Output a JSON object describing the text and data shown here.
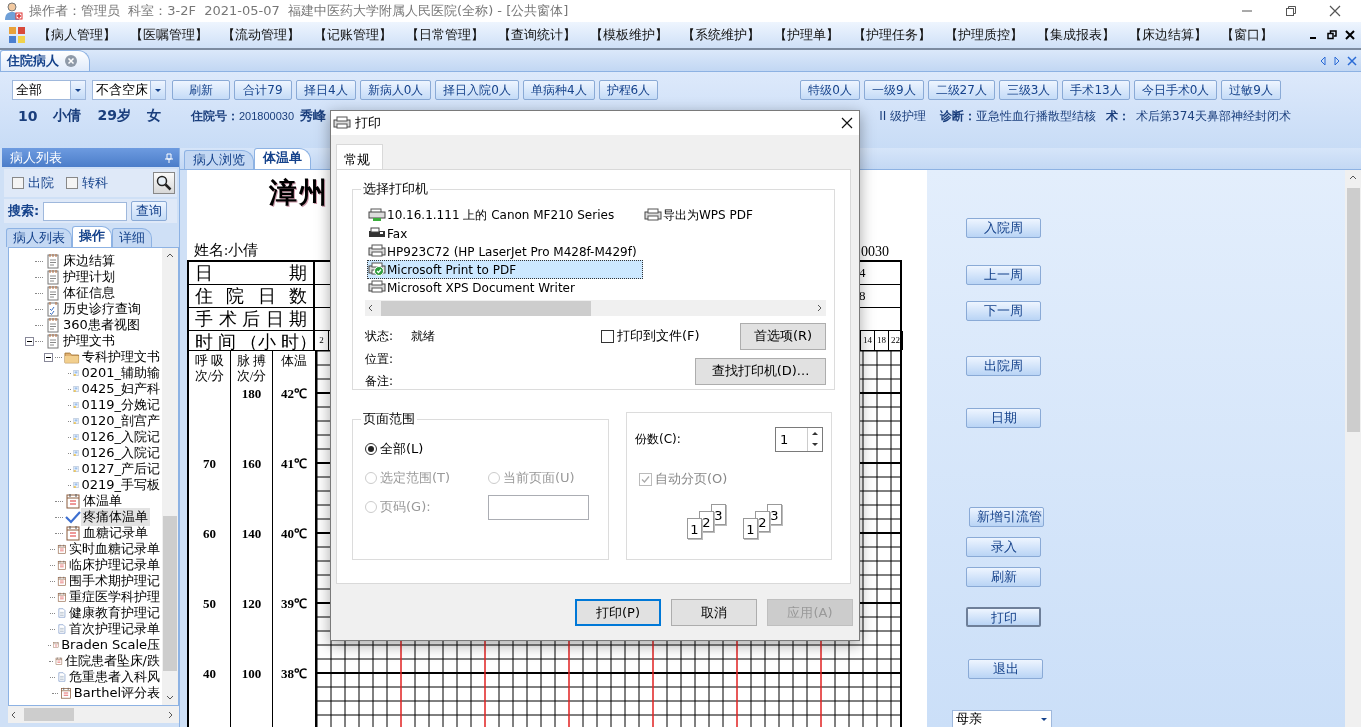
{
  "window": {
    "title": "操作者：管理员  科室：3-2F  2021-05-07  福建中医药大学附属人民医院(全称) - [公共窗体]"
  },
  "menu": [
    "【病人管理】",
    "【医嘱管理】",
    "【流动管理】",
    "【记账管理】",
    "【日常管理】",
    "【查询统计】",
    "【模板维护】",
    "【系统维护】",
    "【护理单】",
    "【护理任务】",
    "【护理质控】",
    "【集成报表】",
    "【床边结算】",
    "【窗口】"
  ],
  "document_tabs": [
    {
      "label": "住院病人",
      "selected": true
    }
  ],
  "toolbar": {
    "filters": [
      "全部",
      "不含空床"
    ],
    "buttons_left": [
      "刷新",
      "合计79",
      "择日4人",
      "新病人0人",
      "择日入院0人",
      "单病种4人",
      "护程6人"
    ],
    "buttons_right": [
      "特级0人",
      "一级9人",
      "二级27人",
      "三级3人",
      "手术13人",
      "今日手术0人",
      "过敏9人"
    ]
  },
  "patient": {
    "bed": "10",
    "name": "小倩",
    "age": "29岁",
    "sex": "女",
    "admission_label": "住院号：",
    "admission_no": "201800030",
    "address": "秀峰",
    "nursing_level": "II 级护理",
    "diagnosis_label": "诊断：",
    "diagnosis": "亚急性血行播散型结核",
    "surgery_label": "术：",
    "surgery": "术后第374天鼻部神经封闭术"
  },
  "patient_panel": {
    "title": "病人列表",
    "filters": [
      {
        "label": "出院",
        "checked": false
      },
      {
        "label": "转科",
        "checked": false
      }
    ],
    "search_label": "搜索:",
    "search_button": "查询",
    "tabs": [
      {
        "label": "病人列表",
        "selected": false
      },
      {
        "label": "操作",
        "selected": true
      },
      {
        "label": "详细",
        "selected": false
      }
    ],
    "tree": [
      {
        "label": "床边结算",
        "kind": "note",
        "selected": false
      },
      {
        "label": "护理计划",
        "kind": "note",
        "selected": false
      },
      {
        "label": "体征信息",
        "kind": "note",
        "selected": false
      },
      {
        "label": "历史诊疗查询",
        "kind": "checklist",
        "selected": false
      },
      {
        "label": "360患者视图",
        "kind": "note",
        "selected": false
      },
      {
        "label": "护理文书",
        "kind": "note",
        "selected": false,
        "expanded": true,
        "children": [
          {
            "label": "专科护理文书",
            "kind": "folder",
            "selected": false,
            "expanded": true,
            "children": [
              {
                "label": "0201_辅助输",
                "kind": "template",
                "selected": false
              },
              {
                "label": "0425_妇产科",
                "kind": "template",
                "selected": false
              },
              {
                "label": "0119_分娩记",
                "kind": "template",
                "selected": false
              },
              {
                "label": "0120_剖宫产",
                "kind": "template",
                "selected": false
              },
              {
                "label": "0126_入院记",
                "kind": "template",
                "selected": false
              },
              {
                "label": "0126_入院记",
                "kind": "template",
                "selected": false
              },
              {
                "label": "0127_产后记",
                "kind": "template",
                "selected": false
              },
              {
                "label": "0219_手写板",
                "kind": "template",
                "selected": false
              }
            ]
          },
          {
            "label": "体温单",
            "kind": "form",
            "selected": false
          },
          {
            "label": "疼痛体温单",
            "kind": "check",
            "selected": true
          },
          {
            "label": "血糖记录单",
            "kind": "form",
            "selected": false
          },
          {
            "label": "实时血糖记录单",
            "kind": "form",
            "selected": false
          },
          {
            "label": "临床护理记录单",
            "kind": "form",
            "selected": false
          },
          {
            "label": "围手术期护理记",
            "kind": "form",
            "selected": false
          },
          {
            "label": "重症医学科护理",
            "kind": "form",
            "selected": false
          },
          {
            "label": "健康教育护理记",
            "kind": "page",
            "selected": false
          },
          {
            "label": "首次护理记录单",
            "kind": "page",
            "selected": false
          },
          {
            "label": "Braden Scale压",
            "kind": "form",
            "selected": false
          },
          {
            "label": "住院患者坠床/跌",
            "kind": "form",
            "selected": false
          },
          {
            "label": "危重患者入科风",
            "kind": "page",
            "selected": false
          },
          {
            "label": "Barthel评分表",
            "kind": "form",
            "selected": false
          }
        ]
      }
    ]
  },
  "chart_sheet": {
    "tabs": [
      {
        "label": "病人浏览",
        "selected": false
      },
      {
        "label": "体温单",
        "selected": true
      }
    ],
    "title": "漳州",
    "name": "姓名:小倩",
    "number_tail": "0030",
    "header_rows": [
      {
        "label": "日 期",
        "tail": "4"
      },
      {
        "label": "住 院 日 数",
        "tail": "8"
      },
      {
        "label": "手 术 后 日 期"
      },
      {
        "label": "时 间 （小 时）"
      }
    ],
    "hour_labels_start": [
      "2"
    ],
    "hour_labels_end": [
      "14",
      "18",
      "22"
    ],
    "scale_headers": [
      [
        "呼 吸",
        "次/分"
      ],
      [
        "脉 搏",
        "次/分"
      ],
      [
        "体温"
      ]
    ],
    "scale_rows": [
      {
        "pulse": "180",
        "temperature": "42℃"
      },
      {
        "respiration": "70",
        "pulse": "160",
        "temperature": "41℃"
      },
      {
        "respiration": "60",
        "pulse": "140",
        "temperature": "40℃"
      },
      {
        "respiration": "50",
        "pulse": "120",
        "temperature": "39℃"
      },
      {
        "respiration": "40",
        "pulse": "100",
        "temperature": "38℃"
      }
    ]
  },
  "side_buttons": [
    {
      "label": "入院周",
      "focused": false
    },
    {
      "label": "上一周",
      "focused": false
    },
    {
      "label": "下一周",
      "focused": false
    },
    {
      "label": "出院周",
      "focused": false
    },
    {
      "label": "日期",
      "focused": false
    },
    {
      "label": "新增引流管",
      "focused": false
    },
    {
      "label": "录入",
      "focused": false
    },
    {
      "label": "刷新",
      "focused": false
    },
    {
      "label": "打印",
      "focused": true
    },
    {
      "label": "退出",
      "focused": false
    }
  ],
  "relation_select": {
    "value": "母亲"
  },
  "print_dialog": {
    "title": "打印",
    "tabs": [
      {
        "label": "常规",
        "selected": true
      }
    ],
    "printer_group": "选择打印机",
    "printers": [
      {
        "name": "10.16.1.111 上的 Canon MF210 Series",
        "kind": "network",
        "selected": false,
        "default": false
      },
      {
        "name": "Fax",
        "kind": "fax",
        "selected": false,
        "default": false
      },
      {
        "name": "HP923C72 (HP LaserJet Pro M428f-M429f)",
        "kind": "printer",
        "selected": false,
        "default": false
      },
      {
        "name": "Microsoft Print to PDF",
        "kind": "printer",
        "selected": true,
        "default": true
      },
      {
        "name": "Microsoft XPS Document Writer",
        "kind": "printer",
        "selected": false,
        "default": false
      },
      {
        "name": "导出为WPS PDF",
        "kind": "printer",
        "selected": false,
        "default": false
      }
    ],
    "status_label": "状态:",
    "status": "就绪",
    "location_label": "位置:",
    "comment_label": "备注:",
    "print_to_file": {
      "label": "打印到文件(F)",
      "checked": false
    },
    "preferences_button": "首选项(R)",
    "find_button": "查找打印机(D)...",
    "range_group": "页面范围",
    "ranges": [
      {
        "label": "全部(L)",
        "selected": true,
        "disabled": false
      },
      {
        "label": "选定范围(T)",
        "selected": false,
        "disabled": true
      },
      {
        "label": "当前页面(U)",
        "selected": false,
        "disabled": true
      },
      {
        "label": "页码(G):",
        "selected": false,
        "disabled": true
      }
    ],
    "copies_label": "份数(C):",
    "copies": "1",
    "collate": {
      "label": "自动分页(O)",
      "checked": true,
      "disabled": true
    },
    "collate_sets": [
      [
        "1",
        "2",
        "3"
      ],
      [
        "1",
        "2",
        "3"
      ]
    ],
    "buttons": [
      {
        "label": "打印(P)",
        "default": true,
        "disabled": false
      },
      {
        "label": "取消",
        "default": false,
        "disabled": false
      },
      {
        "label": "应用(A)",
        "default": false,
        "disabled": true
      }
    ]
  }
}
